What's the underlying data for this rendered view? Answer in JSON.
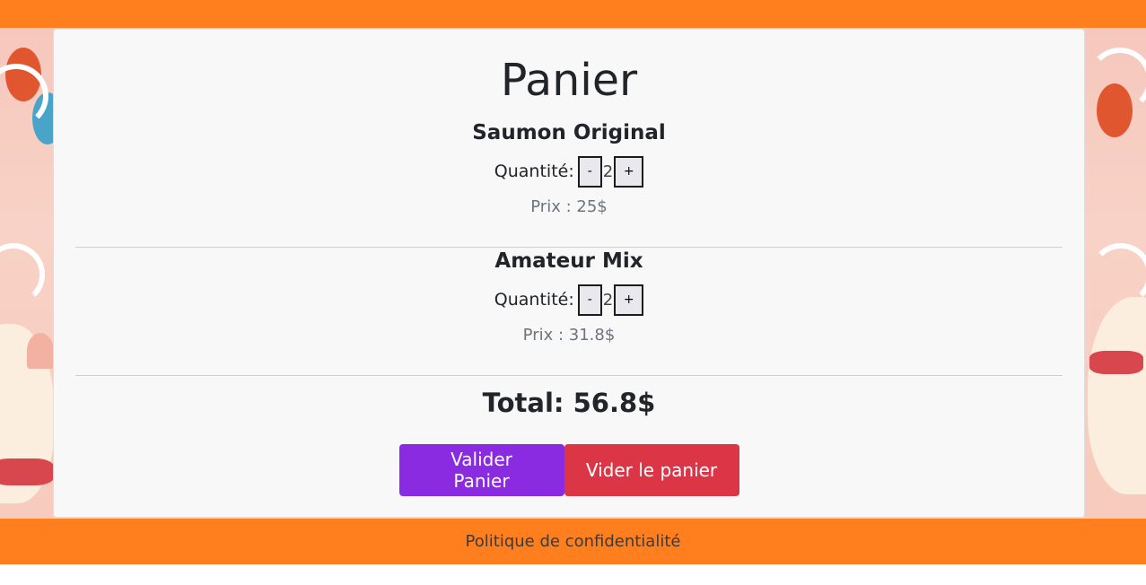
{
  "cart": {
    "title": "Panier",
    "quantity_label": "Quantité:",
    "price_prefix": "Prix : ",
    "items": [
      {
        "name": "Saumon Original",
        "quantity": "2",
        "price": "Prix : 25$"
      },
      {
        "name": "Amateur Mix",
        "quantity": "2",
        "price": "Prix : 31.8$"
      }
    ],
    "decrement_label": "-",
    "increment_label": "+",
    "total": "Total: 56.8$",
    "validate_label": "Valider Panier",
    "clear_label": "Vider le panier"
  },
  "footer": {
    "privacy_link": "Politique de confidentialité"
  },
  "colors": {
    "header_footer": "#ff7f1e",
    "validate_button": "#8a2be2",
    "clear_button": "#dc3545"
  }
}
